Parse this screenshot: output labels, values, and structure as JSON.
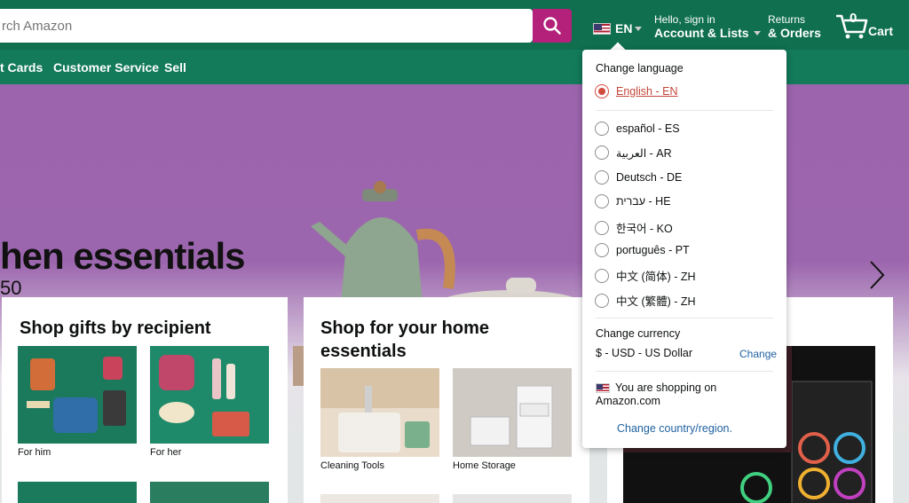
{
  "header": {
    "search_placeholder": "rch Amazon",
    "language_code": "EN",
    "account_line1": "Hello, sign in",
    "account_line2": "Account & Lists",
    "returns_line1": "Returns",
    "returns_line2": "& Orders",
    "cart_count": "0",
    "cart_label": "Cart",
    "colors": {
      "header_bg": "#0f6f4f",
      "search_button": "#b3217a"
    }
  },
  "nav": {
    "items": [
      "t Cards",
      "Customer Service",
      "Sell"
    ]
  },
  "hero": {
    "title": "hen essentials",
    "subtitle": "50"
  },
  "cards": [
    {
      "title": "Shop gifts by recipient",
      "tiles": [
        {
          "label": "For him"
        },
        {
          "label": "For her"
        }
      ]
    },
    {
      "title": "Shop for your home essentials",
      "tiles": [
        {
          "label": "Cleaning Tools"
        },
        {
          "label": "Home Storage"
        }
      ]
    }
  ],
  "flyout": {
    "language_heading": "Change language",
    "languages": [
      {
        "label": "English - EN",
        "selected": true
      },
      {
        "label": "español - ES",
        "selected": false
      },
      {
        "label": "العربية - AR",
        "selected": false
      },
      {
        "label": "Deutsch - DE",
        "selected": false
      },
      {
        "label": "עברית - HE",
        "selected": false
      },
      {
        "label": "한국어 - KO",
        "selected": false
      },
      {
        "label": "português - PT",
        "selected": false
      },
      {
        "label": "中文 (简体) - ZH",
        "selected": false
      },
      {
        "label": "中文 (繁體) - ZH",
        "selected": false
      }
    ],
    "currency_heading": "Change currency",
    "currency_value": "$ - USD - US Dollar",
    "currency_change": "Change",
    "shopping_on": "You are shopping on Amazon.com",
    "change_country": "Change country/region."
  }
}
